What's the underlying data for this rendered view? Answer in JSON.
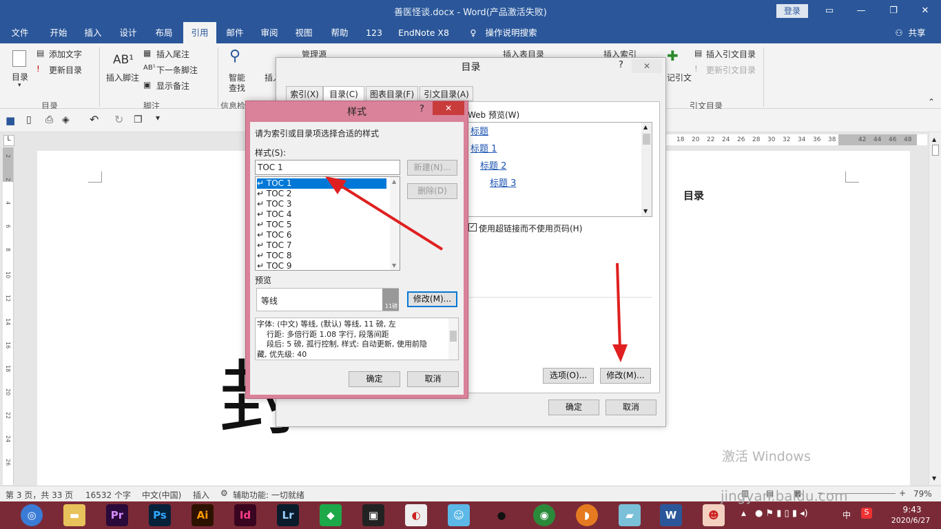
{
  "titlebar": {
    "title": "善医怪谈.docx  -  Word(产品激活失败)",
    "login": "登录"
  },
  "menu": {
    "tabs": [
      "文件",
      "开始",
      "插入",
      "设计",
      "布局",
      "引用",
      "邮件",
      "审阅",
      "视图",
      "帮助",
      "123",
      "EndNote X8"
    ],
    "search": "操作说明搜索",
    "share": "共享"
  },
  "ribbon": {
    "toc": "目录",
    "add_text": "添加文字",
    "update_toc": "更新目录",
    "group_toc": "目录",
    "insert_footnote": "插入脚注",
    "insert_endnote": "插入尾注",
    "next_footnote": "下一条脚注",
    "show_notes": "显示备注",
    "group_footnotes": "脚注",
    "smart_lookup": "智能",
    "smart_lookup2": "查找",
    "group_research": "信息检索",
    "insert_citation": "插入",
    "manage_sources": "管理源",
    "insert_table_of_figures": "插入表目录",
    "insert_index": "插入索引",
    "mark_citation": "记引文",
    "insert_toa": "插入引文目录",
    "update_toa": "更新引文目录",
    "group_toa": "引文目录"
  },
  "ruler": {
    "ticks": [
      "18",
      "20",
      "22",
      "24",
      "26",
      "28",
      "30",
      "32",
      "34",
      "36",
      "38",
      "42",
      "44",
      "46",
      "48"
    ]
  },
  "vruler": {
    "ticks": [
      "2",
      "2",
      "4",
      "6",
      "8",
      "10",
      "12",
      "14",
      "16",
      "18",
      "20",
      "22",
      "24",
      "26"
    ]
  },
  "document": {
    "heading": "目录",
    "big_char": "封"
  },
  "toc_dialog": {
    "title": "目录",
    "help": "?",
    "tabs": [
      "索引(X)",
      "目录(C)",
      "图表目录(F)",
      "引文目录(A)"
    ],
    "web_preview_label": "Web 预览(W)",
    "web_preview": [
      "标题",
      "标题 1",
      "标题 2",
      "标题 3"
    ],
    "use_hyperlinks": "使用超链接而不使用页码(H)",
    "options_button": "选项(O)...",
    "modify_button": "修改(M)...",
    "ok": "确定",
    "cancel": "取消"
  },
  "style_dialog": {
    "title": "样式",
    "help": "?",
    "prompt": "请为索引或目录项选择合适的样式",
    "style_label": "样式(S):",
    "style_value": "TOC 1",
    "styles": [
      "TOC 1",
      "TOC 2",
      "TOC 3",
      "TOC 4",
      "TOC 5",
      "TOC 6",
      "TOC 7",
      "TOC 8",
      "TOC 9"
    ],
    "new_button": "新建(N)...",
    "delete_button": "删除(D)",
    "preview_label": "预览",
    "preview_font": "等线",
    "preview_size": "11磅",
    "modify_button": "修改(M)...",
    "description": [
      "字体: (中文) 等线, (默认) 等线, 11 磅, 左",
      "    行距: 多倍行距 1.08 字行, 段落间距",
      "    段后: 5 磅, 孤行控制, 样式: 自动更新, 使用前隐",
      "藏, 优先级: 40"
    ],
    "ok": "确定",
    "cancel": "取消"
  },
  "statusbar": {
    "page": "第 3 页，共 33 页",
    "words": "16532 个字",
    "lang": "中文(中国)",
    "mode": "插入",
    "accessibility": "辅助功能: 一切就绪",
    "zoom": "79%"
  },
  "watermark": {
    "activate": "激活 Windows",
    "site": "jingyan.baidu.com"
  },
  "taskbar": {
    "time": "9:43",
    "date": "2020/6/27",
    "ime": "中",
    "icons": [
      "Pr",
      "Ps",
      "Ai",
      "Id",
      "Lr"
    ]
  },
  "colors": {
    "word_blue": "#2b579a",
    "style_dialog_frame": "#d9829a",
    "taskbar": "#7a2a37",
    "arrow": "#e02020"
  }
}
